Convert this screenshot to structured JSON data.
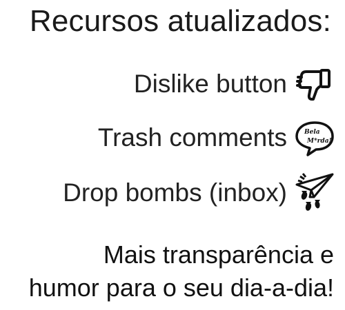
{
  "title": "Recursos atualizados:",
  "features": [
    {
      "label": "Dislike button",
      "icon": "thumbs-down-icon"
    },
    {
      "label": "Trash comments",
      "icon": "speech-bubble-icon",
      "icon_text_1": "Bela",
      "icon_text_2": "M*rda!"
    },
    {
      "label": "Drop bombs (inbox)",
      "icon": "paper-plane-bombs-icon"
    }
  ],
  "tagline": {
    "line1": "Mais transparência e",
    "line2": "humor para o seu dia-a-dia!"
  }
}
